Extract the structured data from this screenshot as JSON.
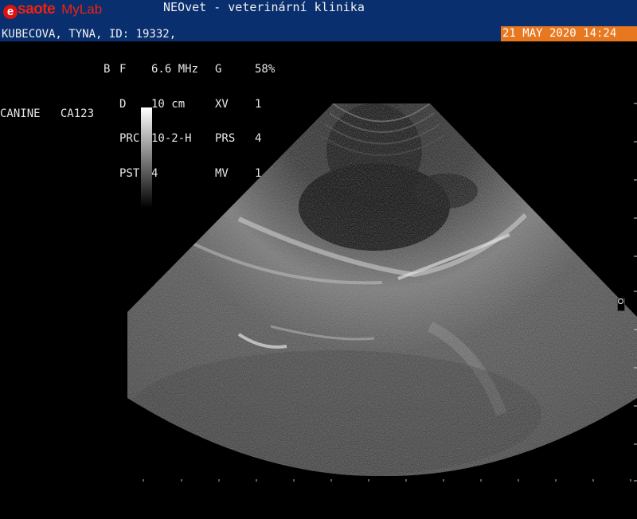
{
  "header": {
    "brand": "saote",
    "brand_e": "e",
    "product": "MyLab",
    "clinic": "NEOvet - veterinární klinika",
    "patient": "KUBECOVA, TYNA, ID: 19332,",
    "datetime": "21 MAY 2020 14:24"
  },
  "params": {
    "mode": "B",
    "rows": [
      {
        "k1": "F",
        "v1": "6.6 MHz",
        "k2": "G",
        "v2": "58%"
      },
      {
        "k1": "D",
        "v1": "10 cm",
        "k2": "XV",
        "v2": "1"
      },
      {
        "k1": "PRC",
        "v1": "10-2-H",
        "k2": "PRS",
        "v2": "4"
      },
      {
        "k1": "PST",
        "v1": "4",
        "k2": "MV",
        "v2": "1"
      }
    ]
  },
  "preset": {
    "species": "CANINE",
    "probe": "CA123"
  },
  "colors": {
    "header_bg": "#0a2f6e",
    "brand_red": "#e21",
    "date_bg": "#e8781f"
  },
  "icons": {
    "focus_marker": "focus-dot-icon"
  }
}
